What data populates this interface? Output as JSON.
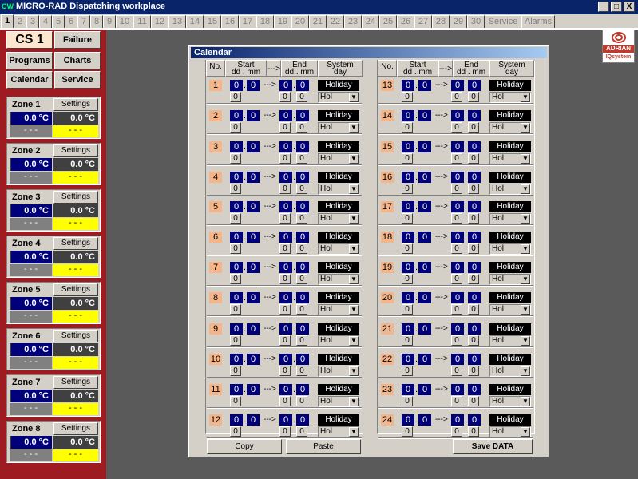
{
  "window": {
    "app_icon": "CW",
    "title": "MICRO-RAD  Dispatching workplace",
    "buttons": [
      "_",
      "□",
      "X"
    ]
  },
  "tabs": [
    "1",
    "2",
    "3",
    "4",
    "5",
    "6",
    "7",
    "8",
    "9",
    "10",
    "11",
    "12",
    "13",
    "14",
    "15",
    "16",
    "17",
    "18",
    "19",
    "20",
    "21",
    "22",
    "23",
    "24",
    "25",
    "26",
    "27",
    "28",
    "29",
    "30",
    "Service",
    "Alarms"
  ],
  "nav": {
    "cs": "CS 1",
    "failure": "Failure",
    "programs": "Programs",
    "charts": "Charts",
    "calendar": "Calendar",
    "service": "Service"
  },
  "zones": [
    {
      "name": "Zone 1",
      "settings": "Settings",
      "temp1": "0.0 °C",
      "temp2": "0.0 °C",
      "status1": "- - -",
      "status2": "- - -"
    },
    {
      "name": "Zone 2",
      "settings": "Settings",
      "temp1": "0.0 °C",
      "temp2": "0.0 °C",
      "status1": "- - -",
      "status2": "- - -"
    },
    {
      "name": "Zone 3",
      "settings": "Settings",
      "temp1": "0.0 °C",
      "temp2": "0.0 °C",
      "status1": "- - -",
      "status2": "- - -"
    },
    {
      "name": "Zone 4",
      "settings": "Settings",
      "temp1": "0.0 °C",
      "temp2": "0.0 °C",
      "status1": "- - -",
      "status2": "- - -"
    },
    {
      "name": "Zone 5",
      "settings": "Settings",
      "temp1": "0.0 °C",
      "temp2": "0.0 °C",
      "status1": "- - -",
      "status2": "- - -"
    },
    {
      "name": "Zone 6",
      "settings": "Settings",
      "temp1": "0.0 °C",
      "temp2": "0.0 °C",
      "status1": "- - -",
      "status2": "- - -"
    },
    {
      "name": "Zone 7",
      "settings": "Settings",
      "temp1": "0.0 °C",
      "temp2": "0.0 °C",
      "status1": "- - -",
      "status2": "- - -"
    },
    {
      "name": "Zone 8",
      "settings": "Settings",
      "temp1": "0.0 °C",
      "temp2": "0.0 °C",
      "status1": "- - -",
      "status2": "- - -"
    }
  ],
  "logo": {
    "brand": "ADRIAN",
    "sub": "IQsystem"
  },
  "calendar": {
    "title": "Calendar",
    "headers": {
      "no": "No.",
      "start": "Start",
      "start_fmt": "dd . mm",
      "arrow": "--->",
      "end": "End",
      "end_fmt": "dd . mm",
      "system": "System",
      "day": "day"
    },
    "entry_defaults": {
      "start_dd": "0",
      "start_mm": "0",
      "end_dd": "0",
      "end_mm": "0",
      "start_small": "0",
      "end_small1": "0",
      "end_small2": "0",
      "holiday": "Holiday",
      "type": "Hol"
    },
    "entries": [
      "1",
      "2",
      "3",
      "4",
      "5",
      "6",
      "7",
      "8",
      "9",
      "10",
      "11",
      "12",
      "13",
      "14",
      "15",
      "16",
      "17",
      "18",
      "19",
      "20",
      "21",
      "22",
      "23",
      "24"
    ],
    "buttons": {
      "copy": "Copy",
      "paste": "Paste",
      "save": "Save DATA"
    }
  }
}
